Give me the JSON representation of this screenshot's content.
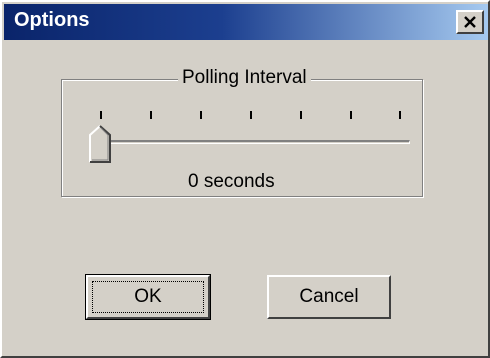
{
  "window": {
    "title": "Options"
  },
  "group": {
    "label": "Polling Interval"
  },
  "slider": {
    "value": 0,
    "tick_count": 8,
    "value_label": "0 seconds"
  },
  "buttons": {
    "ok_label": "OK",
    "cancel_label": "Cancel",
    "close_icon": "close-icon"
  }
}
